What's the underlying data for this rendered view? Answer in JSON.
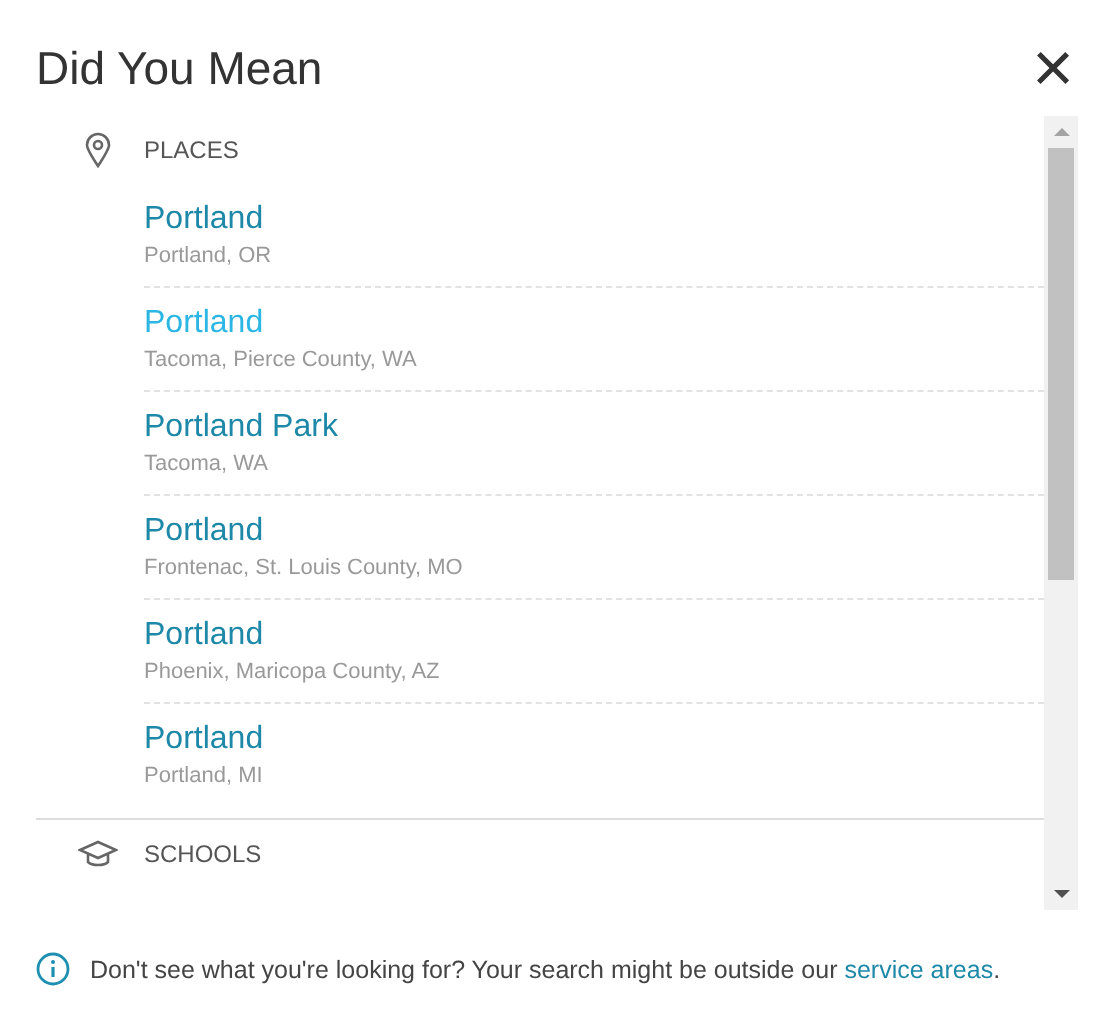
{
  "dialog": {
    "title": "Did You Mean",
    "close": "×"
  },
  "sections": [
    {
      "kind": "places",
      "heading": "PLACES",
      "items": [
        {
          "name": "Portland",
          "detail": "Portland, OR",
          "hovered": false
        },
        {
          "name": "Portland",
          "detail": "Tacoma, Pierce County, WA",
          "hovered": true
        },
        {
          "name": "Portland Park",
          "detail": "Tacoma, WA",
          "hovered": false
        },
        {
          "name": "Portland",
          "detail": "Frontenac, St. Louis County, MO",
          "hovered": false
        },
        {
          "name": "Portland",
          "detail": "Phoenix, Maricopa County, AZ",
          "hovered": false
        },
        {
          "name": "Portland",
          "detail": "Portland, MI",
          "hovered": false
        }
      ]
    },
    {
      "kind": "schools",
      "heading": "SCHOOLS"
    }
  ],
  "footer": {
    "text": "Don't see what you're looking for? Your search might be outside our",
    "link": "service areas",
    "end": "."
  }
}
